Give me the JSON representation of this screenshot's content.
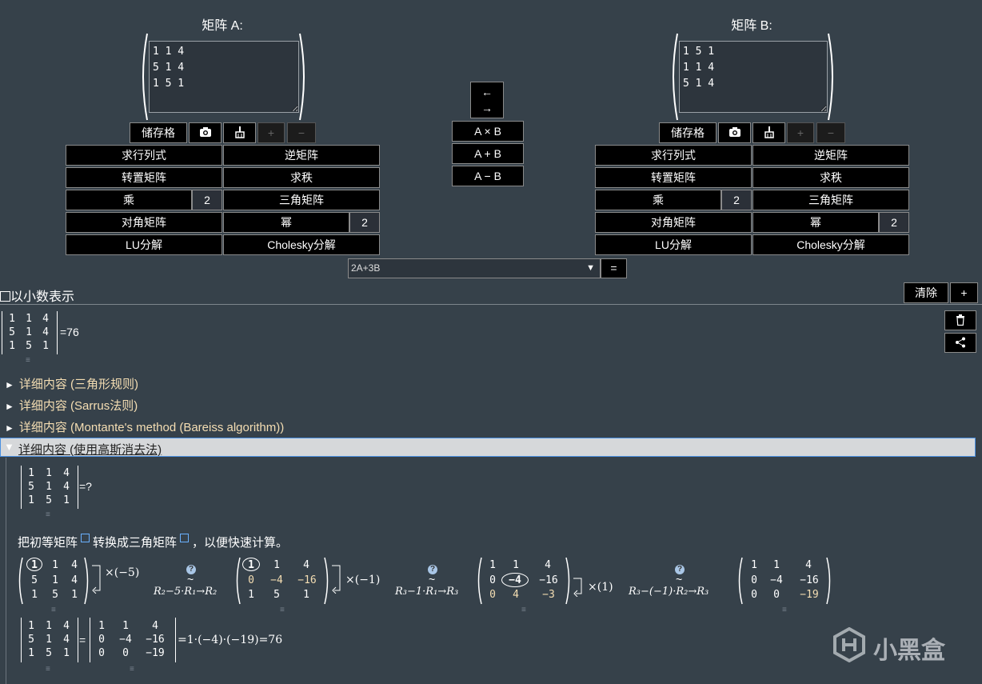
{
  "matrix_a": {
    "title": "矩阵 A:",
    "value": "1 1 4\n5 1 4\n1 5 1"
  },
  "matrix_b": {
    "title": "矩阵 B:",
    "value": "1 5 1\n1 1 4\n5 1 4"
  },
  "toolbar": {
    "store": "储存格",
    "add": "+",
    "remove": "−"
  },
  "ops": {
    "det": "求行列式",
    "inverse": "逆矩阵",
    "transpose": "转置矩阵",
    "rank": "求秩",
    "multiply": "乘",
    "multiply_value": "2",
    "triangular": "三角矩阵",
    "diagonal": "对角矩阵",
    "power": "幂",
    "power_value": "2",
    "lu": "LU分解",
    "cholesky": "Cholesky分解"
  },
  "center": {
    "swap_left": "←",
    "swap_right": "→",
    "axb": "A × B",
    "apb": "A + B",
    "amb": "A − B"
  },
  "expression": {
    "value": "2A+3B",
    "arrow": "▼",
    "equals": "="
  },
  "decimal_label": "以小数表示",
  "clear_label": "清除",
  "plus_label": "+",
  "result": {
    "rows": [
      [
        "1",
        "1",
        "4"
      ],
      [
        "5",
        "1",
        "4"
      ],
      [
        "1",
        "5",
        "1"
      ]
    ],
    "equals_value": "=76"
  },
  "details": [
    {
      "arrow": "►",
      "label": "详细内容 (三角形规则)"
    },
    {
      "arrow": "►",
      "label": "详细内容 (Sarrus法则)"
    },
    {
      "arrow": "►",
      "label": "详细内容 (Montante's method (Bareiss algorithm))"
    }
  ],
  "opened_detail": {
    "arrow": "▼",
    "label": "详细内容 (使用高斯消去法)"
  },
  "gauss": {
    "question": "=?",
    "explanation_1": "把初等矩阵",
    "explanation_2": "转换成三角矩阵",
    "explanation_3": "，以便快速计算。",
    "m1": [
      [
        "1",
        "1",
        "4"
      ],
      [
        "5",
        "1",
        "4"
      ],
      [
        "1",
        "5",
        "1"
      ]
    ],
    "m1_mult": "×(−5)",
    "op1": "R₂−5·R₁→R₂",
    "m2": [
      [
        "1",
        "1",
        "4"
      ],
      [
        "0",
        "−4",
        "−16"
      ],
      [
        "1",
        "5",
        "1"
      ]
    ],
    "m2_mult": "×(−1)",
    "op2": "R₃−1·R₁→R₃",
    "m3": [
      [
        "1",
        "1",
        "4"
      ],
      [
        "0",
        "−4",
        "−16"
      ],
      [
        "0",
        "4",
        "−3"
      ]
    ],
    "m3_mult": "×(1)",
    "op3": "R₃−(−1)·R₂→R₃",
    "m4": [
      [
        "1",
        "1",
        "4"
      ],
      [
        "0",
        "−4",
        "−16"
      ],
      [
        "0",
        "0",
        "−19"
      ]
    ],
    "tilde": "~",
    "q": "?",
    "final_eq": "=",
    "final_result": "=1·(−4)·(−19)=76"
  },
  "watermark": "小黑盒"
}
